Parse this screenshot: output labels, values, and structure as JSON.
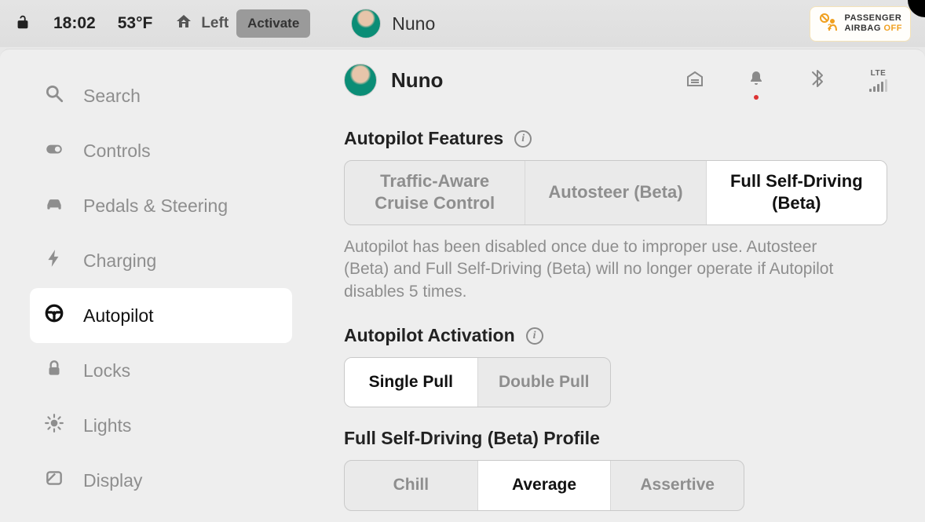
{
  "topbar": {
    "time": "18:02",
    "temperature": "53°F",
    "home_side": "Left",
    "activate_label": "Activate",
    "profile_name": "Nuno",
    "airbag_line1": "PASSENGER",
    "airbag_line2_a": "AIRBAG ",
    "airbag_line2_b": "OFF"
  },
  "sidebar": {
    "items": [
      {
        "label": "Search"
      },
      {
        "label": "Controls"
      },
      {
        "label": "Pedals & Steering"
      },
      {
        "label": "Charging"
      },
      {
        "label": "Autopilot"
      },
      {
        "label": "Locks"
      },
      {
        "label": "Lights"
      },
      {
        "label": "Display"
      }
    ]
  },
  "main": {
    "profile_name": "Nuno",
    "lte_label": "LTE",
    "features": {
      "title": "Autopilot Features",
      "options": [
        "Traffic-Aware Cruise Control",
        "Autosteer (Beta)",
        "Full Self-Driving (Beta)"
      ],
      "warning": "Autopilot has been disabled once due to improper use. Autosteer (Beta) and Full Self-Driving (Beta) will no longer operate if Autopilot disables 5 times."
    },
    "activation": {
      "title": "Autopilot Activation",
      "options": [
        "Single Pull",
        "Double Pull"
      ]
    },
    "fsd_profile": {
      "title": "Full Self-Driving (Beta) Profile",
      "options": [
        "Chill",
        "Average",
        "Assertive"
      ]
    }
  }
}
